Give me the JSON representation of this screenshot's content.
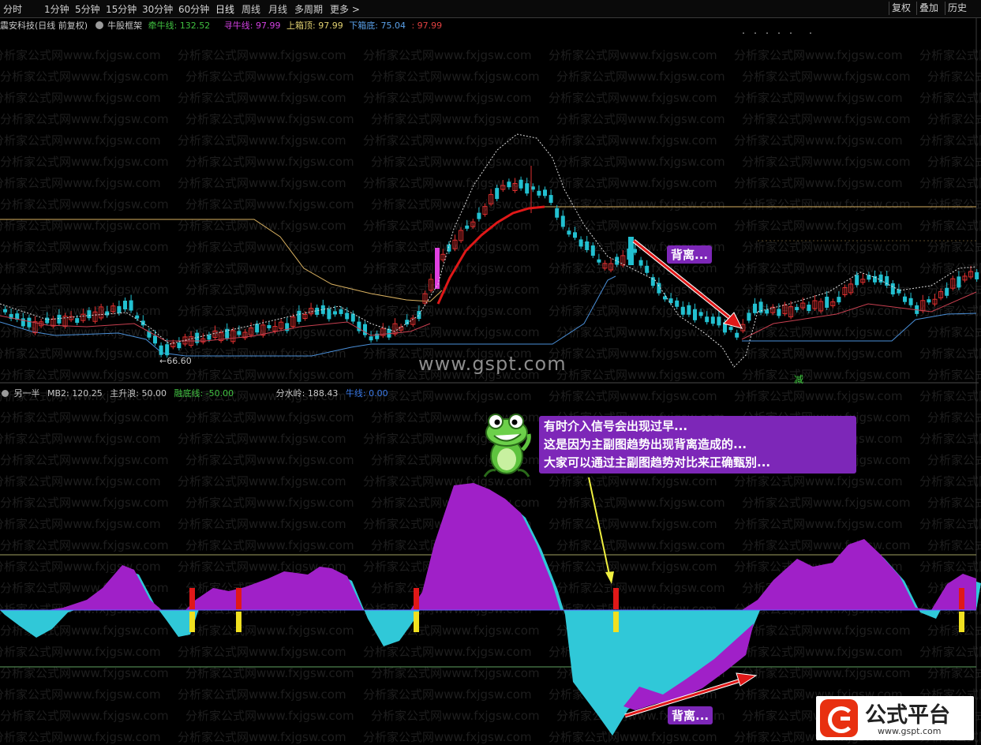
{
  "toolbar": {
    "periods": [
      "分时",
      "1分钟",
      "5分钟",
      "15分钟",
      "30分钟",
      "60分钟",
      "日线",
      "周线",
      "月线",
      "多周期",
      "更多"
    ],
    "right_buttons": [
      "复权",
      "叠加",
      "历史"
    ]
  },
  "main_info": {
    "stock_title": "震安科技(日线 前复权)",
    "indicator_name": "牛股框架",
    "line1_label": "牵牛线:",
    "line1_value": "132.52",
    "line2_label": "寻牛线:",
    "line2_value": "97.99",
    "line3_label": "上箱顶:",
    "line3_value": "97.99",
    "line4_label": "下箱底:",
    "line4_value": "75.04",
    "line5_value": ": 97.99"
  },
  "main_chart": {
    "low_price_label": "←66.60",
    "signal_char": "减",
    "site_watermark": "www.gspt.com"
  },
  "sub_info": {
    "name": "另一半",
    "mb2_label": "MB2:",
    "mb2_value": "120.25",
    "zsl_label": "主升浪:",
    "zsl_value": "50.00",
    "rdx_label": "融底线:",
    "rdx_value": "-50.00",
    "fsl_label": "分水岭:",
    "fsl_value": "188.43",
    "nx_label": "牛线:",
    "nx_value": "0.00"
  },
  "annotations": {
    "divergence_top": "背离...",
    "divergence_bottom": "背离...",
    "callout_lines": [
      "有时介入信号会出现过早...",
      "这是因为主副图趋势出现背离造成的...",
      "大家可以通过主副图趋势对比来正确甄别..."
    ]
  },
  "watermark_text": "分析家公式网www.fxjgsw.com",
  "logo": {
    "text": "公式平台",
    "url": "www.gspt.com"
  },
  "colors": {
    "up": "#e03030",
    "down": "#22c0d0",
    "purple": "#a020c8",
    "cyan": "#30c8d8",
    "red_line": "#e01818",
    "blue_line": "#4a8fd8",
    "gold_line": "#d8b060"
  }
}
